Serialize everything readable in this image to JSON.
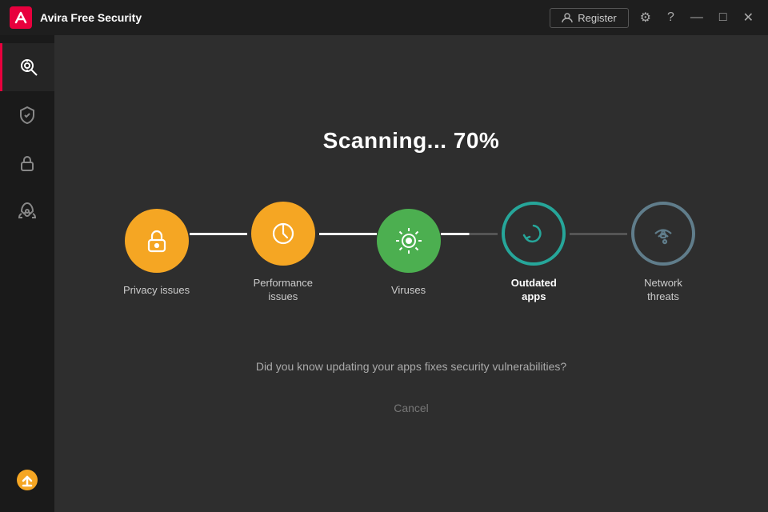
{
  "titlebar": {
    "app_name": "Avira",
    "app_subtitle": "Free Security",
    "register_label": "Register",
    "settings_title": "Settings",
    "help_title": "Help",
    "minimize_title": "Minimize",
    "maximize_title": "Maximize",
    "close_title": "Close"
  },
  "sidebar": {
    "items": [
      {
        "name": "scan",
        "label": "Scan",
        "active": true
      },
      {
        "name": "protection",
        "label": "Protection",
        "active": false
      },
      {
        "name": "privacy",
        "label": "Privacy",
        "active": false
      },
      {
        "name": "performance",
        "label": "Performance",
        "active": false
      }
    ],
    "bottom": {
      "name": "update",
      "label": "Update"
    }
  },
  "main": {
    "scanning_label": "Scanning... 70%",
    "steps": [
      {
        "id": "privacy",
        "label": "Privacy issues",
        "state": "done",
        "icon": "lock"
      },
      {
        "id": "performance",
        "label": "Performance issues",
        "state": "done",
        "icon": "gauge"
      },
      {
        "id": "viruses",
        "label": "Viruses",
        "state": "done",
        "icon": "virus"
      },
      {
        "id": "outdated",
        "label": "Outdated apps",
        "state": "active",
        "icon": "refresh"
      },
      {
        "id": "network",
        "label": "Network threats",
        "state": "todo",
        "icon": "wifi-lock"
      }
    ],
    "connectors": [
      {
        "id": "c1",
        "state": "done"
      },
      {
        "id": "c2",
        "state": "done"
      },
      {
        "id": "c3",
        "state": "partial"
      },
      {
        "id": "c4",
        "state": "todo"
      }
    ],
    "info_text": "Did you know updating your apps fixes security vulnerabilities?",
    "cancel_label": "Cancel"
  }
}
